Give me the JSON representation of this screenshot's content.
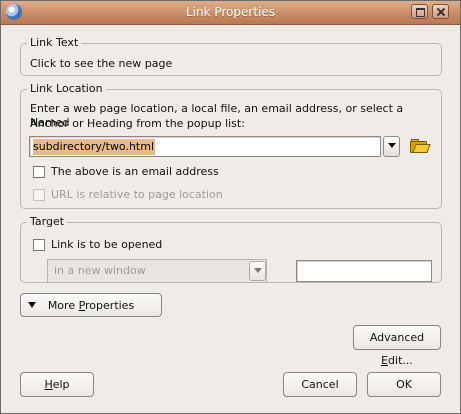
{
  "window": {
    "title": "Link Properties",
    "maximize_icon": "maximize-icon",
    "close_icon": "close-icon"
  },
  "link_text": {
    "legend": "Link Text",
    "value": "Click to see the new page"
  },
  "link_location": {
    "legend": "Link Location",
    "instructions_line1": "Enter a web page location, a local file, an email address, or select a Named",
    "instructions_line2": "Anchor or Heading from the popup list:",
    "url_value": "subdirectory/two.html",
    "email_checkbox": "The above is an email address",
    "relative_checkbox": "URL is relative to page location",
    "browse_icon": "folder-open-icon"
  },
  "target": {
    "legend": "Target",
    "open_checkbox": "Link is to be opened",
    "open_option": "in a new window",
    "custom_target_value": ""
  },
  "buttons": {
    "more_properties": "More Properties",
    "more_properties_prefix": "More ",
    "more_properties_mnemonic": "P",
    "more_properties_suffix": "roperties",
    "advanced_edit_prefix": "Advanced ",
    "advanced_edit_mnemonic": "E",
    "advanced_edit_suffix": "dit...",
    "help_mnemonic": "H",
    "help_suffix": "elp",
    "cancel": "Cancel",
    "ok": "OK"
  }
}
